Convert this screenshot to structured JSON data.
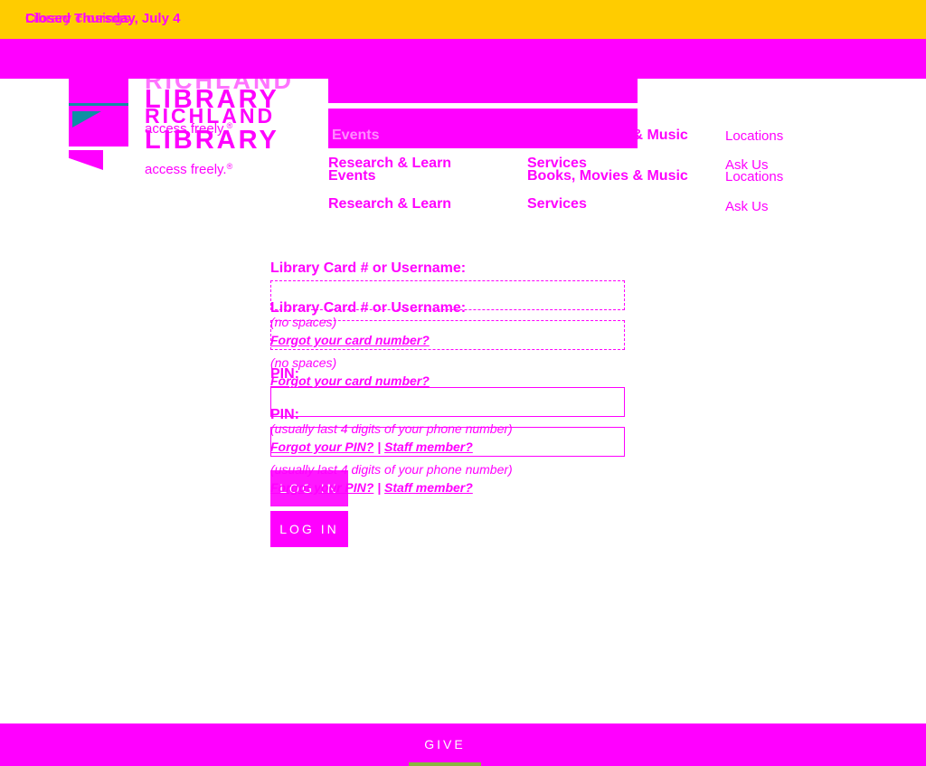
{
  "alert": {
    "text_a": "Closed Thursday, July 4",
    "text_b": "Library closings"
  },
  "logo": {
    "name_top": "RICHLAND",
    "name_bottom": "LIBRARY",
    "tagline": "access freely.",
    "registered": "®"
  },
  "nav": {
    "events": "Events",
    "books": "Books, Movies & Music",
    "locations": "Locations",
    "research": "Research & Learn",
    "services": "Services",
    "askus": "Ask Us"
  },
  "form": {
    "card_label": "Library Card # or Username:",
    "card_hint": "(no spaces)",
    "forgot_card": "Forgot your card number?",
    "pin_label": "PIN:",
    "pin_hint": "(usually last 4 digits of your phone number)",
    "forgot_pin": "Forgot your PIN?",
    "separator": "|",
    "staff": "Staff member?",
    "login": "LOG IN"
  },
  "footer": {
    "give": "GIVE"
  },
  "colors": {
    "alert_bg": "#ffcc00",
    "accent": "#ff00ff",
    "logo_teal": "#0e8fa3",
    "give_underline": "#8ab73f"
  }
}
